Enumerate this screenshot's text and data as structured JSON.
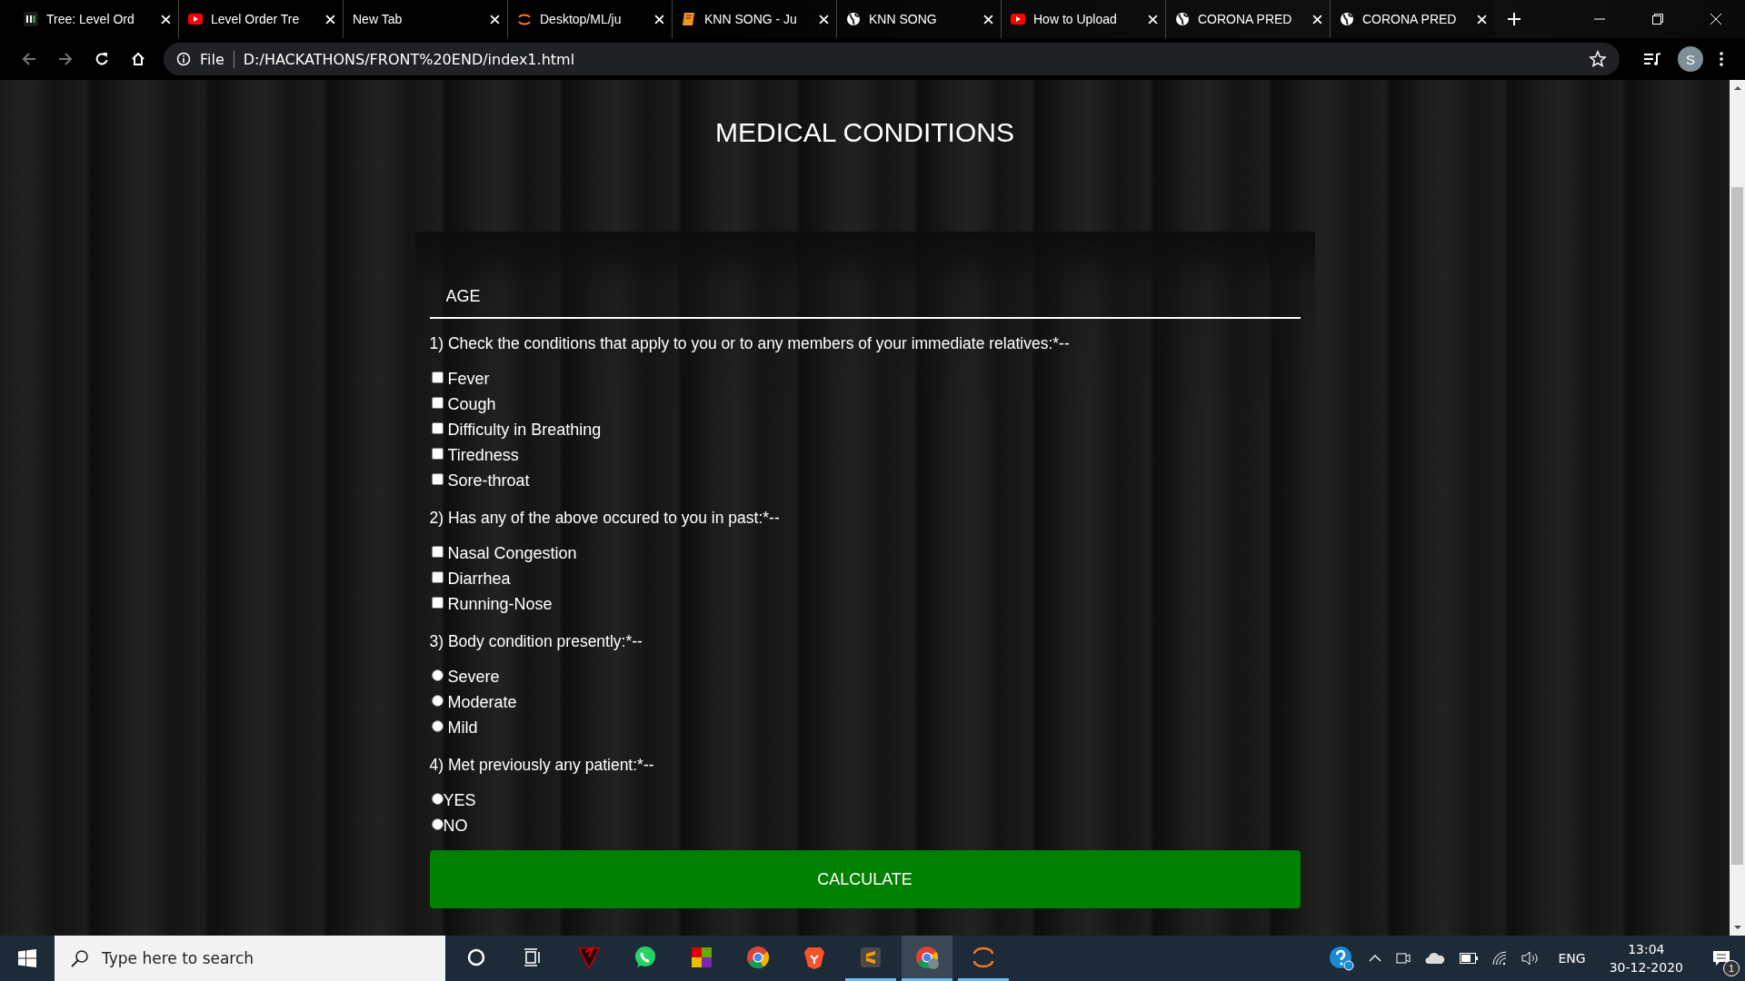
{
  "browser": {
    "tabs": [
      {
        "title": "Tree: Level Ord",
        "kind": "gfg",
        "selected": false
      },
      {
        "title": "Level Order Tre",
        "kind": "youtube",
        "selected": false
      },
      {
        "title": "New Tab",
        "kind": "blank",
        "selected": false
      },
      {
        "title": "Desktop/ML/ju",
        "kind": "jupyter",
        "selected": false
      },
      {
        "title": "KNN SONG - Ju",
        "kind": "book",
        "selected": false
      },
      {
        "title": "KNN SONG",
        "kind": "globe",
        "selected": false
      },
      {
        "title": "How to Upload",
        "kind": "youtube",
        "selected": false
      },
      {
        "title": "CORONA PRED",
        "kind": "globe",
        "selected": false
      },
      {
        "title": "CORONA PRED",
        "kind": "globe",
        "selected": true
      }
    ],
    "address": {
      "scheme": "File",
      "url": "D:/HACKATHONS/FRONT%20END/index1.html"
    },
    "profile_initial": "S"
  },
  "page": {
    "heading": "MEDICAL CONDITIONS",
    "age_field": {
      "placeholder": "AGE"
    },
    "questions": [
      {
        "text": "1) Check the conditions that apply to you or to any members of your immediate relatives:*--",
        "kind": "checkbox",
        "options": [
          {
            "label": "Fever",
            "checked": false
          },
          {
            "label": "Cough",
            "checked": false
          },
          {
            "label": "Difficulty in Breathing",
            "checked": false
          },
          {
            "label": "Tiredness",
            "checked": false
          },
          {
            "label": "Sore-throat",
            "checked": false
          }
        ]
      },
      {
        "text": "2) Has any of the above occured to you in past:*--",
        "kind": "checkbox",
        "options": [
          {
            "label": "Nasal Congestion",
            "checked": false
          },
          {
            "label": "Diarrhea",
            "checked": false
          },
          {
            "label": "Running-Nose",
            "checked": false
          }
        ]
      },
      {
        "text": "3) Body condition presently:*--",
        "kind": "radio",
        "options": [
          {
            "label": "Severe",
            "selected": false
          },
          {
            "label": "Moderate",
            "selected": false
          },
          {
            "label": "Mild",
            "selected": false
          }
        ]
      },
      {
        "text": "4) Met previously any patient:*--",
        "kind": "radio-tight",
        "options": [
          {
            "label": "YES",
            "selected": false
          },
          {
            "label": "NO",
            "selected": false
          }
        ]
      }
    ],
    "button": "CALCULATE"
  },
  "taskbar": {
    "search_placeholder": "Type here to search",
    "apps": [
      {
        "kind": "cortana",
        "running": false,
        "selected": false
      },
      {
        "kind": "taskview",
        "running": false,
        "selected": false
      },
      {
        "kind": "triangle",
        "running": false,
        "selected": false
      },
      {
        "kind": "whatsapp",
        "running": false,
        "selected": false
      },
      {
        "kind": "squares",
        "running": false,
        "selected": false
      },
      {
        "kind": "chrome",
        "running": false,
        "selected": false
      },
      {
        "kind": "brave",
        "running": false,
        "selected": false
      },
      {
        "kind": "sublime",
        "running": true,
        "selected": false
      },
      {
        "kind": "chrome-profile",
        "running": true,
        "selected": true
      },
      {
        "kind": "jupyter",
        "running": true,
        "selected": false
      }
    ],
    "language": "ENG",
    "time": "13:04",
    "date": "30-12-2020",
    "notification_count": "1"
  }
}
